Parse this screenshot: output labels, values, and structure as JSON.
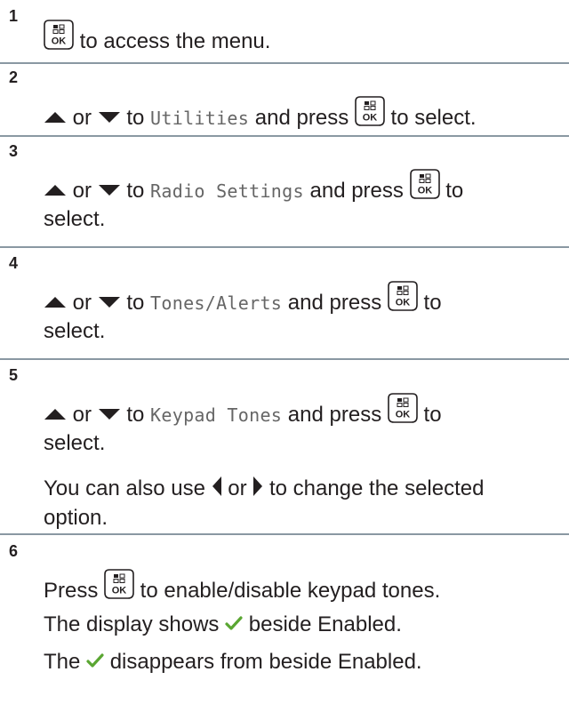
{
  "steps": [
    {
      "number": "1",
      "lines": [
        {
          "parts": [
            {
              "t": "icon",
              "name": "ok-button-icon"
            },
            {
              "t": "text",
              "v": " to access the menu."
            }
          ]
        }
      ]
    },
    {
      "number": "2",
      "lines": [
        {
          "parts": [
            {
              "t": "icon",
              "name": "up-arrow-icon"
            },
            {
              "t": "text",
              "v": " or "
            },
            {
              "t": "icon",
              "name": "down-arrow-icon"
            },
            {
              "t": "text",
              "v": " to "
            },
            {
              "t": "mono",
              "v": "Utilities"
            },
            {
              "t": "text",
              "v": " and press "
            },
            {
              "t": "icon",
              "name": "ok-button-icon"
            },
            {
              "t": "text",
              "v": " to select."
            }
          ]
        }
      ]
    },
    {
      "number": "3",
      "lines": [
        {
          "parts": [
            {
              "t": "icon",
              "name": "up-arrow-icon"
            },
            {
              "t": "text",
              "v": " or "
            },
            {
              "t": "icon",
              "name": "down-arrow-icon"
            },
            {
              "t": "text",
              "v": " to "
            },
            {
              "t": "mono",
              "v": "Radio Settings"
            },
            {
              "t": "text",
              "v": " and press "
            },
            {
              "t": "icon",
              "name": "ok-button-icon"
            },
            {
              "t": "text",
              "v": " to"
            }
          ]
        },
        {
          "parts": [
            {
              "t": "text",
              "v": "select."
            }
          ]
        }
      ]
    },
    {
      "number": "4",
      "lines": [
        {
          "parts": [
            {
              "t": "icon",
              "name": "up-arrow-icon"
            },
            {
              "t": "text",
              "v": " or "
            },
            {
              "t": "icon",
              "name": "down-arrow-icon"
            },
            {
              "t": "text",
              "v": " to "
            },
            {
              "t": "mono",
              "v": "Tones/Alerts"
            },
            {
              "t": "text",
              "v": " and press "
            },
            {
              "t": "icon",
              "name": "ok-button-icon"
            },
            {
              "t": "text",
              "v": " to"
            }
          ]
        },
        {
          "parts": [
            {
              "t": "text",
              "v": "select."
            }
          ]
        }
      ]
    },
    {
      "number": "5",
      "lines": [
        {
          "parts": [
            {
              "t": "icon",
              "name": "up-arrow-icon"
            },
            {
              "t": "text",
              "v": " or "
            },
            {
              "t": "icon",
              "name": "down-arrow-icon"
            },
            {
              "t": "text",
              "v": " to "
            },
            {
              "t": "mono",
              "v": "Keypad Tones"
            },
            {
              "t": "text",
              "v": " and press "
            },
            {
              "t": "icon",
              "name": "ok-button-icon"
            },
            {
              "t": "text",
              "v": " to"
            }
          ]
        },
        {
          "parts": [
            {
              "t": "text",
              "v": "select."
            }
          ]
        },
        {
          "parts": [
            {
              "t": "text",
              "v": "You can also use "
            },
            {
              "t": "icon",
              "name": "left-arrow-icon"
            },
            {
              "t": "text",
              "v": " or "
            },
            {
              "t": "icon",
              "name": "right-arrow-icon"
            },
            {
              "t": "text",
              "v": " to change the selected"
            }
          ]
        },
        {
          "parts": [
            {
              "t": "text",
              "v": "option."
            }
          ]
        }
      ]
    },
    {
      "number": "6",
      "lines": [
        {
          "parts": [
            {
              "t": "text",
              "v": "Press "
            },
            {
              "t": "icon",
              "name": "ok-button-icon"
            },
            {
              "t": "text",
              "v": " to enable/disable keypad tones."
            }
          ]
        },
        {
          "parts": [
            {
              "t": "text",
              "v": "The display shows "
            },
            {
              "t": "icon",
              "name": "checkmark-icon"
            },
            {
              "t": "text",
              "v": " beside Enabled."
            }
          ]
        },
        {
          "parts": [
            {
              "t": "text",
              "v": "The "
            },
            {
              "t": "icon",
              "name": "checkmark-icon"
            },
            {
              "t": "text",
              "v": " disappears from beside Enabled."
            }
          ]
        }
      ]
    }
  ],
  "colors": {
    "text": "#231f20",
    "divider": "#8a98a2",
    "checkmark": "#5aa632",
    "mono_text": "#666666"
  }
}
